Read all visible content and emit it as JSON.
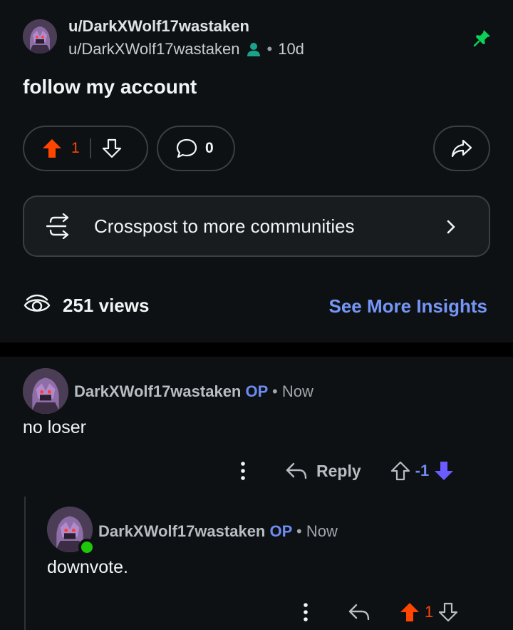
{
  "post": {
    "community": "u/DarkXWolf17wastaken",
    "author": "u/DarkXWolf17wastaken",
    "separator": "•",
    "time": "10d",
    "title": "follow my account",
    "vote_count": "1",
    "comment_count": "0",
    "crosspost_label": "Crosspost to more communities",
    "views": "251 views",
    "insights_link": "See More Insights"
  },
  "comments": [
    {
      "author": "DarkXWolf17wastaken",
      "op_badge": "OP",
      "separator": "•",
      "time": "Now",
      "body": "no loser",
      "reply_label": "Reply",
      "score": "-1",
      "vote_state": "downvoted"
    },
    {
      "author": "DarkXWolf17wastaken",
      "op_badge": "OP",
      "separator": "•",
      "time": "Now",
      "body": "downvote.",
      "score": "1",
      "vote_state": "upvoted",
      "online": true
    }
  ],
  "icons": {
    "pin": "pin-icon",
    "upvote": "upvote-arrow-icon",
    "downvote": "downvote-arrow-icon",
    "comment": "comment-bubble-icon",
    "share": "share-arrow-icon",
    "crosspost": "crosspost-icon",
    "views": "eye-icon",
    "more": "more-vertical-icon",
    "reply": "reply-arrow-icon"
  },
  "colors": {
    "background": "#0e1113",
    "upvote": "#ff4500",
    "downvote": "#6a5cff",
    "accent_link": "#7596f7",
    "op_badge": "#6c8cf0",
    "pin": "#0dd157",
    "online": "#1fc70a"
  }
}
